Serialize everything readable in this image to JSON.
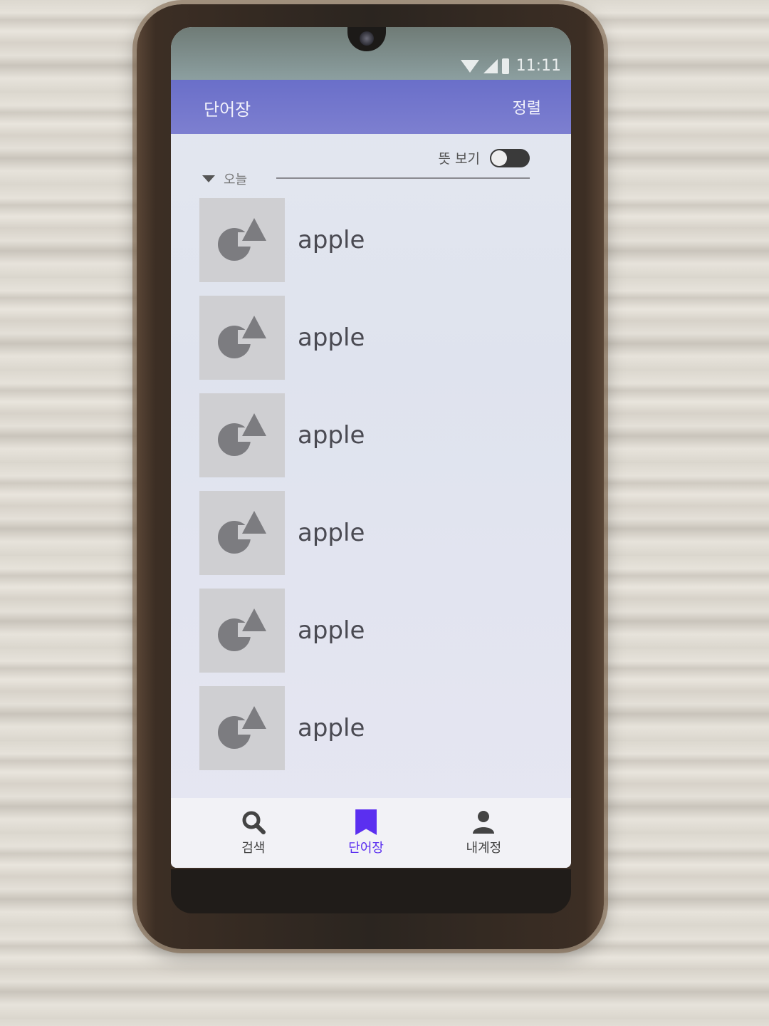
{
  "status_bar": {
    "time": "11:11"
  },
  "app_bar": {
    "title": "단어장",
    "sort_label": "정렬"
  },
  "meaning_toggle": {
    "label": "뜻 보기",
    "enabled": false
  },
  "section": {
    "label": "오늘",
    "expanded": true
  },
  "word_list": {
    "items": [
      {
        "word": "apple",
        "thumbnail": "image-placeholder-icon"
      },
      {
        "word": "apple",
        "thumbnail": "image-placeholder-icon"
      },
      {
        "word": "apple",
        "thumbnail": "image-placeholder-icon"
      },
      {
        "word": "apple",
        "thumbnail": "image-placeholder-icon"
      },
      {
        "word": "apple",
        "thumbnail": "image-placeholder-icon"
      },
      {
        "word": "apple",
        "thumbnail": "image-placeholder-icon"
      }
    ]
  },
  "bottom_nav": {
    "items": [
      {
        "label": "검색",
        "icon": "search-icon",
        "active": false
      },
      {
        "label": "단어장",
        "icon": "bookmark-icon",
        "active": true
      },
      {
        "label": "내계정",
        "icon": "person-icon",
        "active": false
      }
    ]
  },
  "colors": {
    "app_bar": "#6a6fc9",
    "nav_active": "#5b2ff0",
    "toggle_track": "#3a3a3a"
  }
}
